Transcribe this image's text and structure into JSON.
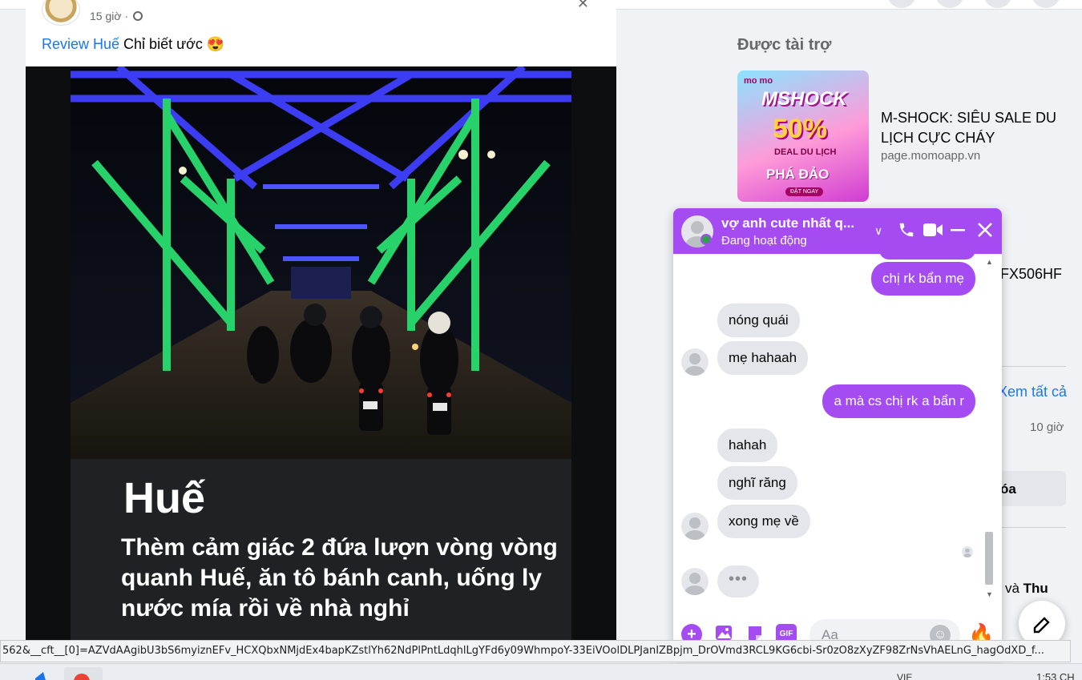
{
  "post": {
    "time": "15 giờ",
    "separator": "·",
    "caption_link": "Review Huế",
    "caption_text": " Chỉ biết ước 😍",
    "image_city": "Huế",
    "image_quote": "Thèm cảm giác 2 đứa lượn vòng vòng quanh Huế, ăn tô bánh canh, uống ly nước mía rồi về nhà nghỉ"
  },
  "sidebar": {
    "sponsored_title": "Được tài trợ",
    "ad1": {
      "title": "M-SHOCK: SIÊU SALE DU LỊCH CỰC CHÁY",
      "domain": "page.momoapp.vn",
      "thumb_brand": "mo mo",
      "thumb_headline": "MSHOCK",
      "thumb_percent": "50%",
      "thumb_deal": "DEAL DU LỊCH",
      "thumb_phadao": "PHÁ ĐẢO",
      "thumb_button": "ĐẶT NGAY"
    },
    "ad2_title": "FX506HF",
    "see_all": "Xem tất cả",
    "hours": "10 giờ",
    "button_partial": "óa",
    "text_partial": "ei và ",
    "text_bold": "Thu"
  },
  "chat": {
    "name": "vợ anh cute nhất q...",
    "status": "Đang hoạt động",
    "input_placeholder": "Aa",
    "typing_dots": "•••",
    "messages": [
      {
        "dir": "out",
        "text": "chị rk bẩn mẹ"
      },
      {
        "dir": "in",
        "text": "nóng quái"
      },
      {
        "dir": "in",
        "text": "mẹ hahaah"
      },
      {
        "dir": "out",
        "text": "a mà cs chị rk a bẩn r"
      },
      {
        "dir": "in",
        "text": "hahah"
      },
      {
        "dir": "in",
        "text": "nghĩ răng"
      },
      {
        "dir": "in",
        "text": "xong mẹ về"
      }
    ]
  },
  "status_url": "562&__cft__[0]=AZVdAAgibU3bS6myiznEFv_HCXQbxNMjdEx4bapKZstlYh62NdPlPntLdqhlLgYFd6y09WhmpoY-33EiVOolDLPJanIZBpjm_DrOVmd3RCL9KG6cbi-Sr0zO8zXyZF98ZrNsVhAELnG_hagOdXD_f...",
  "taskbar": {
    "lang": "VIE",
    "clock": "1:53 CH"
  },
  "colors": {
    "messenger_accent": "#a44cf2",
    "facebook_link": "#1877f2",
    "online": "#31a24c"
  }
}
